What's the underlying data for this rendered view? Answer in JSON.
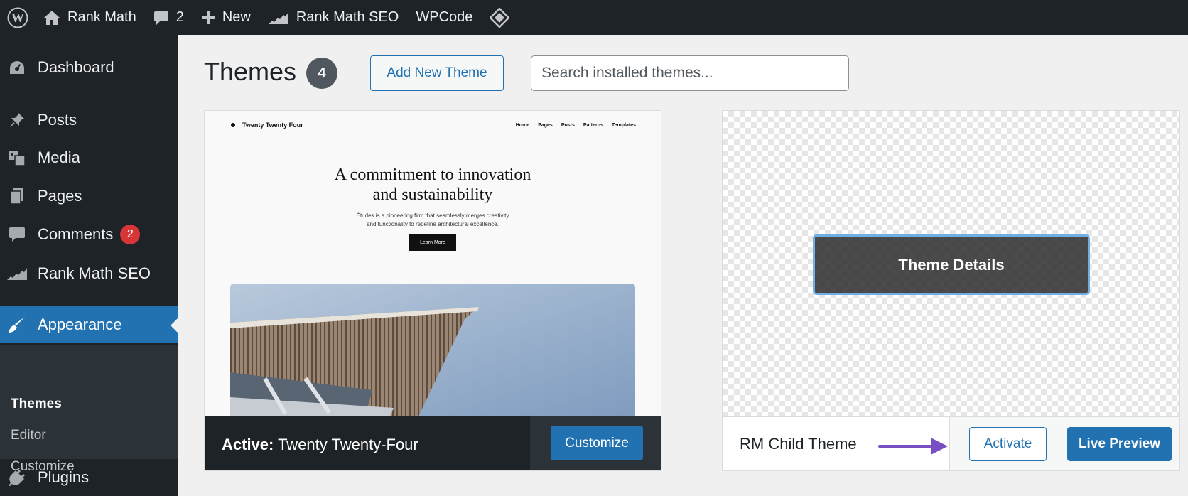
{
  "adminbar": {
    "site_name": "Rank Math",
    "comments_count": "2",
    "new_label": "New",
    "rankmath_label": "Rank Math SEO",
    "wpcode_label": "WPCode"
  },
  "sidebar": {
    "dashboard": "Dashboard",
    "posts": "Posts",
    "media": "Media",
    "pages": "Pages",
    "comments": "Comments",
    "comments_badge": "2",
    "rankmath": "Rank Math SEO",
    "appearance": "Appearance",
    "sub_themes": "Themes",
    "sub_editor": "Editor",
    "sub_customize": "Customize",
    "plugins": "Plugins"
  },
  "header": {
    "title": "Themes",
    "count": "4",
    "add_new_label": "Add New Theme",
    "search_placeholder": "Search installed themes..."
  },
  "theme_active": {
    "preview": {
      "site_title": "Twenty Twenty Four",
      "nav": [
        "Home",
        "Pages",
        "Posts",
        "Patterns",
        "Templates"
      ],
      "heading_line1": "A commitment to innovation",
      "heading_line2": "and sustainability",
      "body_line1": "Études is a pioneering firm that seamlessly merges creativity",
      "body_line2": "and functionality to redefine architectural excellence.",
      "button": "Learn More"
    },
    "active_prefix": "Active:",
    "name": "Twenty Twenty-Four",
    "customize_label": "Customize"
  },
  "theme_other": {
    "details_label": "Theme Details",
    "name": "RM Child Theme",
    "activate_label": "Activate",
    "live_preview_label": "Live Preview"
  },
  "colors": {
    "admin_dark": "#1d2327",
    "wp_blue": "#2271b1",
    "badge_red": "#d63638",
    "annotation_arrow": "#7b4fc4"
  }
}
